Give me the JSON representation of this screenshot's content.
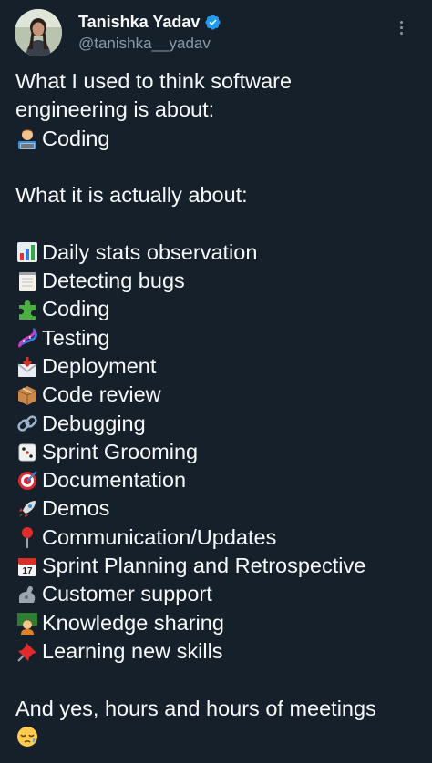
{
  "author": {
    "display_name": "Tanishka Yadav",
    "handle": "@tanishka__yadav",
    "verified": true,
    "avatar_icon": "profile-photo"
  },
  "menu_icon": "more-vertical-icon",
  "tweet": {
    "intro_line1": "What I used to think software",
    "intro_line2": "engineering is about:",
    "intro_item": {
      "icon": "technologist-emoji",
      "text": "Coding"
    },
    "actual_heading": "What it is actually about:",
    "items": [
      {
        "icon": "bar-chart-emoji",
        "text": "Daily stats observation"
      },
      {
        "icon": "notepad-emoji",
        "text": "Detecting bugs"
      },
      {
        "icon": "puzzle-piece-emoji",
        "text": "Coding"
      },
      {
        "icon": "dna-emoji",
        "text": "Testing"
      },
      {
        "icon": "envelope-arrow-emoji",
        "text": "Deployment"
      },
      {
        "icon": "package-emoji",
        "text": "Code review"
      },
      {
        "icon": "link-emoji",
        "text": "Debugging"
      },
      {
        "icon": "dice-emoji",
        "text": "Sprint Grooming"
      },
      {
        "icon": "target-emoji",
        "text": "Documentation"
      },
      {
        "icon": "rocket-emoji",
        "text": "Demos"
      },
      {
        "icon": "round-pushpin-emoji",
        "text": "Communication/Updates"
      },
      {
        "icon": "calendar-emoji",
        "text": "Sprint Planning and Retrospective"
      },
      {
        "icon": "mechanical-arm-emoji",
        "text": "Customer support"
      },
      {
        "icon": "teacher-emoji",
        "text": "Knowledge sharing"
      },
      {
        "icon": "pushpin-emoji",
        "text": "Learning new skills"
      }
    ],
    "closing_line": "And yes, hours and hours of meetings",
    "closing_emoji": "sleepy-face-emoji"
  },
  "colors": {
    "background": "#15202b",
    "text": "#f7f9f9",
    "secondary_text": "#8b98a5",
    "verified_blue": "#1d9bf0"
  }
}
